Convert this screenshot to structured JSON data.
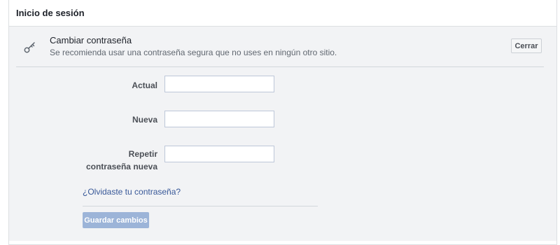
{
  "header": {
    "title": "Inicio de sesión"
  },
  "change_password": {
    "title": "Cambiar contraseña",
    "subtitle": "Se recomienda usar una contraseña segura que no uses en ningún otro sitio.",
    "close_label": "Cerrar",
    "icon": "key-icon"
  },
  "form": {
    "current_label": "Actual",
    "current_value": "",
    "new_label": "Nueva",
    "new_value": "",
    "repeat_label_line1": "Repetir",
    "repeat_label_line2": "contraseña nueva",
    "repeat_value": "",
    "forgot_link": "¿Olvidaste tu contraseña?",
    "save_label": "Guardar cambios",
    "save_enabled": false
  },
  "colors": {
    "link": "#385898",
    "save_disabled_bg": "#9cb4d8",
    "body_bg": "#f2f3f5"
  }
}
